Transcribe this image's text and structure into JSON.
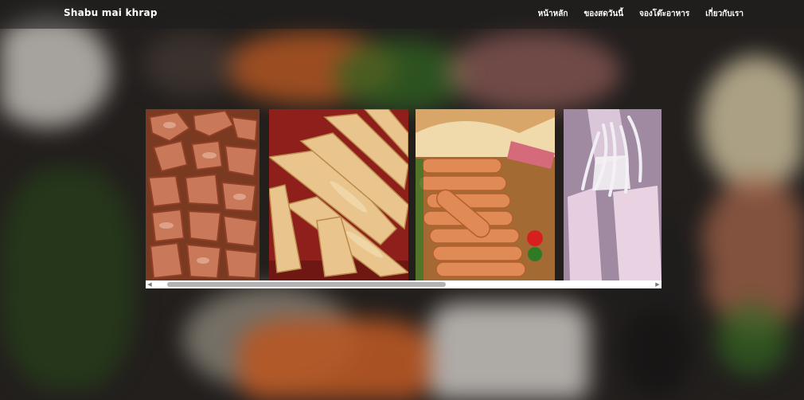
{
  "site": {
    "brand": "Shabu mai khrap"
  },
  "nav": {
    "items": [
      {
        "label": "หน้าหลัก"
      },
      {
        "label": "ของสดวันนี้"
      },
      {
        "label": "จองโต๊ะอาหาร"
      },
      {
        "label": "เกี่ยวกับเรา"
      }
    ]
  },
  "gallery": {
    "images": [
      {
        "subject": "sliced-pork"
      },
      {
        "subject": "squid-strips"
      },
      {
        "subject": "sausages"
      },
      {
        "subject": "whole-squid"
      }
    ],
    "scrollbar": {
      "left_arrow": "◀",
      "right_arrow": "▶",
      "position": 0.06
    }
  },
  "colors": {
    "nav_background": "#1e1e1e",
    "nav_text": "#ffffff",
    "scroll_track": "#ffffff",
    "scroll_thumb": "#b3b3b3"
  }
}
